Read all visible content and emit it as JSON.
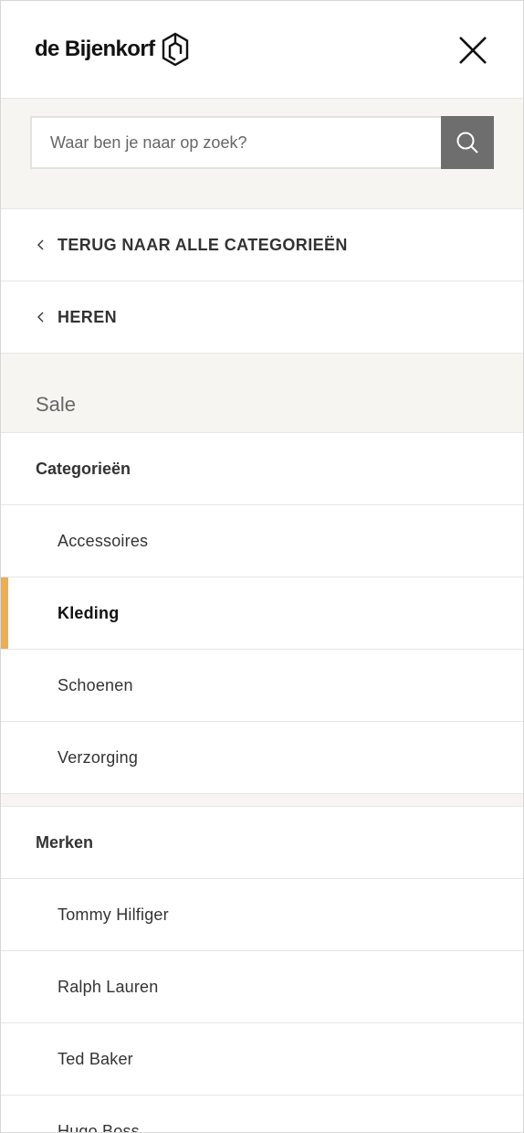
{
  "brand": {
    "logo_text": "de Bijenkorf",
    "logo_icon": "bijenkorf-hexagon-icon"
  },
  "search": {
    "placeholder": "Waar ben je naar op zoek?",
    "icon": "search-icon"
  },
  "nav": {
    "back_all": "TERUG NAAR ALLE CATEGORIEËN",
    "back_parent": "HEREN"
  },
  "current_section": "Sale",
  "categories": {
    "title": "Categorieën",
    "items": [
      {
        "label": "Accessoires",
        "active": false
      },
      {
        "label": "Kleding",
        "active": true
      },
      {
        "label": "Schoenen",
        "active": false
      },
      {
        "label": "Verzorging",
        "active": false
      }
    ]
  },
  "brands": {
    "title": "Merken",
    "items": [
      {
        "label": "Tommy Hilfiger"
      },
      {
        "label": "Ralph Lauren"
      },
      {
        "label": "Ted Baker"
      },
      {
        "label": "Hugo Boss"
      }
    ]
  },
  "colors": {
    "accent": "#f0ad4e",
    "band_bg": "#f6f5f1",
    "search_button": "#6e6e6e",
    "divider": "#e6e6e6"
  }
}
